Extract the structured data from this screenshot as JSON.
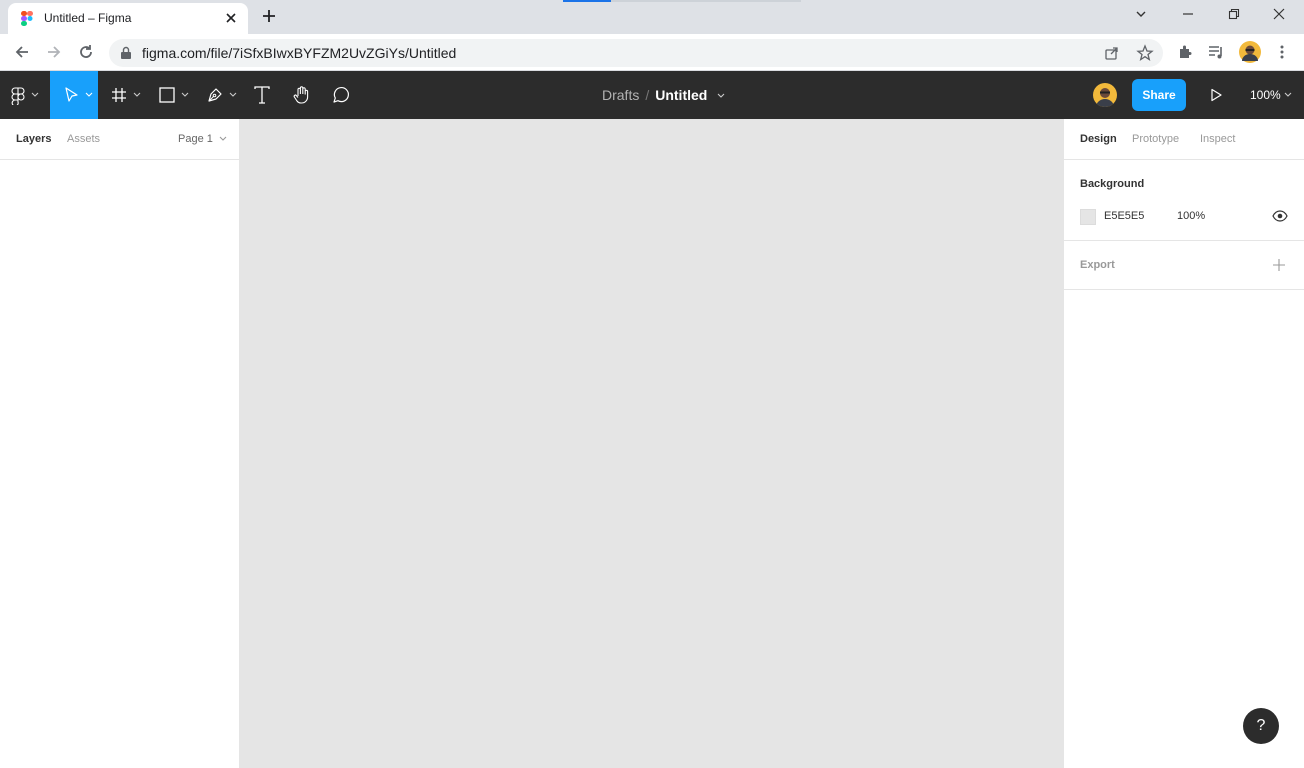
{
  "browser": {
    "tab_title": "Untitled – Figma",
    "url": "figma.com/file/7iSfxBIwxBYFZM2UvZGiYs/Untitled"
  },
  "toolbar": {
    "breadcrumb_project": "Drafts",
    "breadcrumb_separator": "/",
    "file_name": "Untitled",
    "share_label": "Share",
    "zoom": "100%",
    "accent_color": "#18a0fb"
  },
  "left_panel": {
    "tabs": {
      "layers": "Layers",
      "assets": "Assets"
    },
    "page": "Page 1"
  },
  "right_panel": {
    "tabs": {
      "design": "Design",
      "prototype": "Prototype",
      "inspect": "Inspect"
    },
    "background": {
      "title": "Background",
      "hex": "E5E5E5",
      "opacity": "100%"
    },
    "export": {
      "title": "Export"
    }
  },
  "help": {
    "label": "?"
  }
}
